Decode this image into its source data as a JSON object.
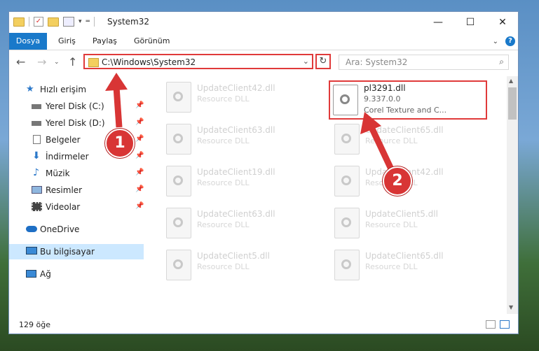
{
  "window": {
    "title": "System32"
  },
  "controls": {
    "minimize": "—",
    "maximize": "☐",
    "close": "✕"
  },
  "ribbon": {
    "file_tab": "Dosya",
    "tabs": [
      "Giriş",
      "Paylaş",
      "Görünüm"
    ],
    "help": "?"
  },
  "nav": {
    "address": "C:\\Windows\\System32",
    "search_placeholder": "Ara: System32"
  },
  "sidebar": {
    "quick_access": "Hızlı erişim",
    "items": [
      {
        "label": "Yerel Disk (C:)",
        "icon": "drive-icon"
      },
      {
        "label": "Yerel Disk (D:)",
        "icon": "drive-icon"
      },
      {
        "label": "Belgeler",
        "icon": "documents-icon"
      },
      {
        "label": "İndirmeler",
        "icon": "downloads-icon"
      },
      {
        "label": "Müzik",
        "icon": "music-icon"
      },
      {
        "label": "Resimler",
        "icon": "pictures-icon"
      },
      {
        "label": "Videolar",
        "icon": "videos-icon"
      }
    ],
    "onedrive": "OneDrive",
    "this_pc": "Bu bilgisayar",
    "network": "Ağ"
  },
  "files": [
    {
      "name": "UpdateClient42.dll",
      "desc": "Resource DLL"
    },
    {
      "name": "pl3291.dll",
      "version": "9.337.0.0",
      "desc": "Corel Texture and C...",
      "highlighted": true
    },
    {
      "name": "UpdateClient63.dll",
      "desc": "Resource DLL"
    },
    {
      "name": "UpdateClient65.dll",
      "desc": "Resource DLL"
    },
    {
      "name": "UpdateClient19.dll",
      "desc": "Resource DLL"
    },
    {
      "name": "UpdateClient42.dll",
      "desc": "Resource DLL"
    },
    {
      "name": "UpdateClient63.dll",
      "desc": "Resource DLL"
    },
    {
      "name": "UpdateClient5.dll",
      "desc": "Resource DLL"
    },
    {
      "name": "UpdateClient5.dll",
      "desc": "Resource DLL"
    },
    {
      "name": "UpdateClient65.dll",
      "desc": "Resource DLL"
    }
  ],
  "status": {
    "count": "129 öğe"
  },
  "annotations": {
    "one": "1",
    "two": "2",
    "color": "#d83535"
  }
}
